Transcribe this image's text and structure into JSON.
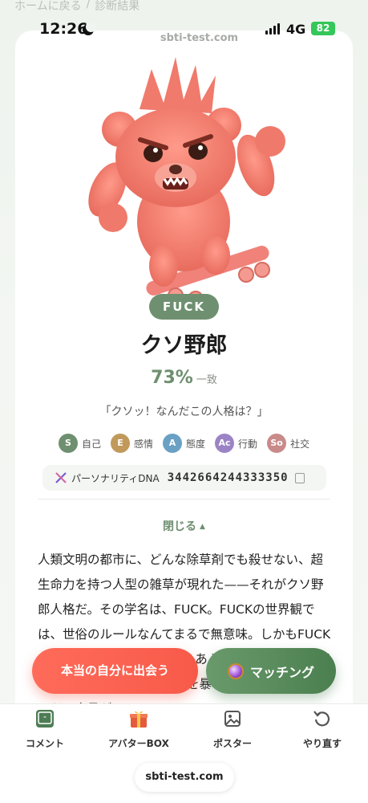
{
  "breadcrumb": {
    "home": "ホームに戻る",
    "sep": "/",
    "current": "診断結果"
  },
  "status": {
    "time": "12:26",
    "network": "4G",
    "battery": "82"
  },
  "site_url": "sbti-test.com",
  "result": {
    "type_code": "FUCK",
    "type_name": "クソ野郎",
    "match_percent": "73%",
    "match_label": "一致",
    "quote": "「クソッ！なんだこの人格は？」"
  },
  "dimensions": [
    {
      "letter": "S",
      "label": "自己",
      "color": "#6f9070"
    },
    {
      "letter": "E",
      "label": "感情",
      "color": "#c19a5b"
    },
    {
      "letter": "A",
      "label": "態度",
      "color": "#6aa0c4"
    },
    {
      "letter": "Ac",
      "label": "行動",
      "color": "#9b84c5"
    },
    {
      "letter": "So",
      "label": "社交",
      "color": "#c98a8a"
    }
  ],
  "dna": {
    "label": "パーソナリティDNA",
    "code": "3442664244333350"
  },
  "toggle_label": "閉じる",
  "description": "人類文明の都市に、どんな除草剤でも殺せない、超生命力を持つ人型の雑草が現れた——それがクソ野郎人格だ。その学名は、FUCK。FUCKの世界観では、世俗のルールなんてまるで無意味。しかもFUCKの感情は、FUCKの内側からあふれ出す。それはただのわがままじゃない。体内を暴れ回る生命力そのものだ。全員が",
  "actions": {
    "primary": "本当の自分に出会う",
    "secondary": "マッチング"
  },
  "bottom_nav": [
    {
      "label": "コメント",
      "icon": "comment-icon"
    },
    {
      "label": "アバターBOX",
      "icon": "gift-icon"
    },
    {
      "label": "ポスター",
      "icon": "image-icon"
    },
    {
      "label": "やり直す",
      "icon": "retry-icon"
    }
  ],
  "footer_url": "sbti-test.com"
}
